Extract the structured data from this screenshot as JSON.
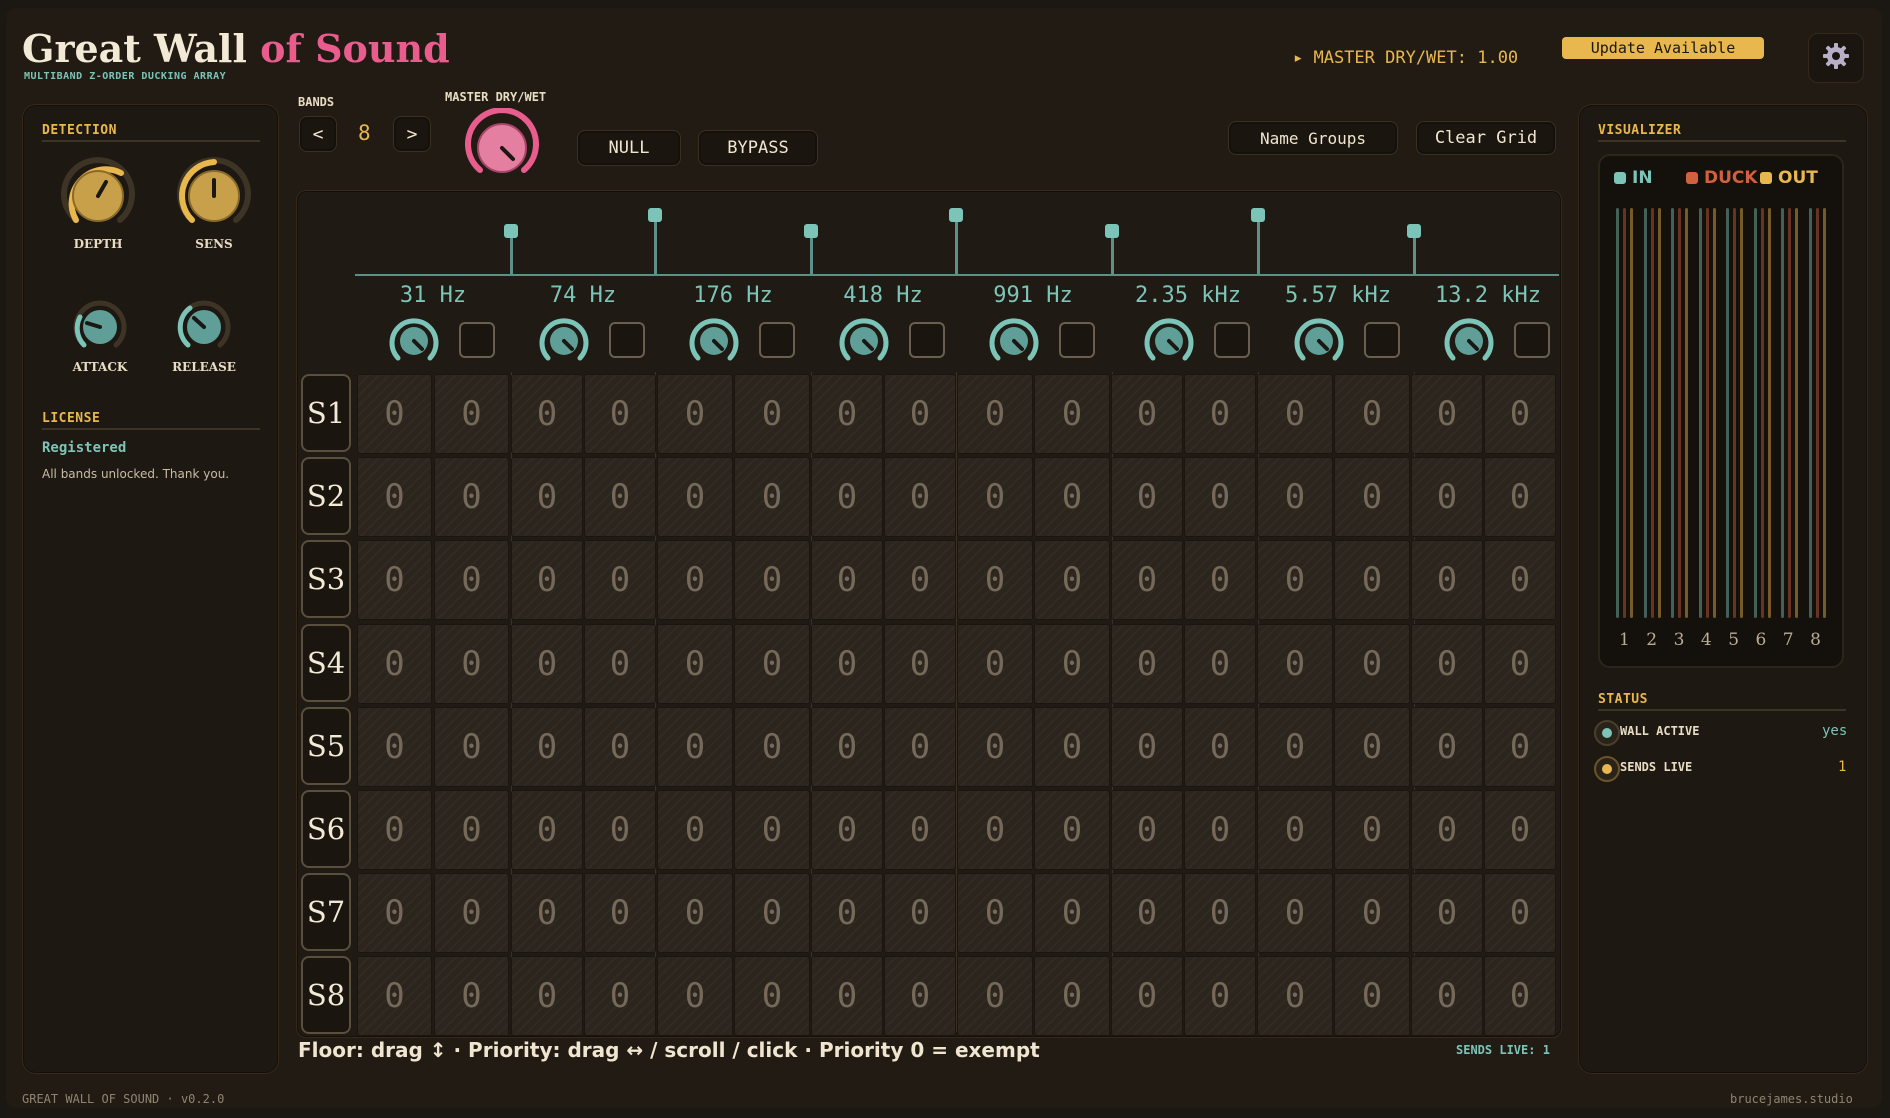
{
  "app": {
    "title_part1": "Great Wall",
    "title_part2": "of Sound",
    "subtitle": "MULTIBAND Z-ORDER DUCKING ARRAY",
    "master_readout": "▸ MASTER DRY/WET: 1.00",
    "update_button": "Update Available",
    "footer_version": "GREAT WALL OF SOUND · v0.2.0",
    "footer_site": "brucejames.studio"
  },
  "colors": {
    "accent_gold": "#e8b84e",
    "accent_pink": "#e85c8e",
    "accent_teal": "#7dc4b8",
    "duck": "#d0603e"
  },
  "detection": {
    "title": "DETECTION",
    "knobs": [
      {
        "label": "DEPTH",
        "value": 0.6
      },
      {
        "label": "SENS",
        "value": 0.5
      },
      {
        "label": "ATTACK",
        "value": 0.3
      },
      {
        "label": "RELEASE",
        "value": 0.35
      }
    ]
  },
  "license": {
    "title": "LICENSE",
    "status": "Registered",
    "message": "All bands unlocked. Thank you."
  },
  "bands": {
    "label": "BANDS",
    "prev": "<",
    "next": ">",
    "count": "8",
    "master_label": "MASTER DRY/WET",
    "master_value": 1.0,
    "null_button": "NULL",
    "bypass_button": "BYPASS",
    "name_groups_button": "Name Groups",
    "clear_grid_button": "Clear Grid",
    "frequencies": [
      "31 Hz",
      "74 Hz",
      "176 Hz",
      "418 Hz",
      "991 Hz",
      "2.35 kHz",
      "5.57 kHz",
      "13.2 kHz"
    ]
  },
  "grid": {
    "rows": [
      "S1",
      "S2",
      "S3",
      "S4",
      "S5",
      "S6",
      "S7",
      "S8"
    ],
    "columns": 16,
    "cell_value": "0"
  },
  "help_text": "Floor: drag ↕ · Priority: drag ↔ / scroll / click · Priority 0 = exempt",
  "sends_live_footer": "SENDS LIVE: 1",
  "visualizer": {
    "title": "VISUALIZER",
    "legend": [
      "IN",
      "DUCK",
      "OUT"
    ],
    "bands": [
      "1",
      "2",
      "3",
      "4",
      "5",
      "6",
      "7",
      "8"
    ]
  },
  "status": {
    "title": "STATUS",
    "items": [
      {
        "label": "WALL ACTIVE",
        "value": "yes"
      },
      {
        "label": "SENDS LIVE",
        "value": "1"
      }
    ]
  }
}
